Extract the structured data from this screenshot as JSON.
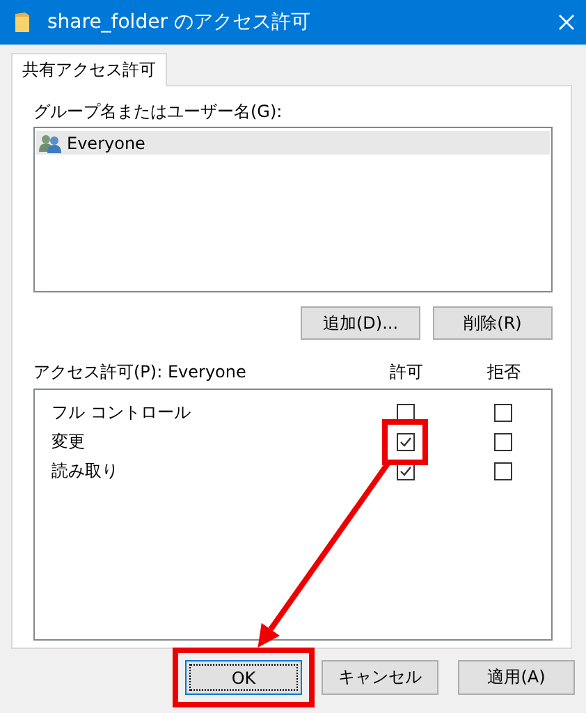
{
  "window": {
    "title": "share_folder のアクセス許可"
  },
  "tabs": [
    {
      "label": "共有アクセス許可",
      "selected": true
    }
  ],
  "users": {
    "label": "グループ名またはユーザー名(G):",
    "items": [
      {
        "name": "Everyone",
        "selected": true
      }
    ]
  },
  "user_buttons": [
    "追加(D)...",
    "削除(R)"
  ],
  "permissions": {
    "label": "アクセス許可(P): Everyone",
    "columns": [
      "許可",
      "拒否"
    ],
    "rows": [
      {
        "name": "フル コントロール",
        "allow": false,
        "deny": false,
        "highlighted": false
      },
      {
        "name": "変更",
        "allow": true,
        "deny": false,
        "highlighted": true
      },
      {
        "name": "読み取り",
        "allow": true,
        "deny": false,
        "highlighted": false
      }
    ]
  },
  "buttons": [
    {
      "label": "OK",
      "focused": true,
      "highlighted": true
    },
    {
      "label": "キャンセル",
      "focused": false,
      "highlighted": false
    },
    {
      "label": "適用(A)",
      "focused": false,
      "highlighted": false
    }
  ],
  "annotations": {
    "arrow": true
  }
}
